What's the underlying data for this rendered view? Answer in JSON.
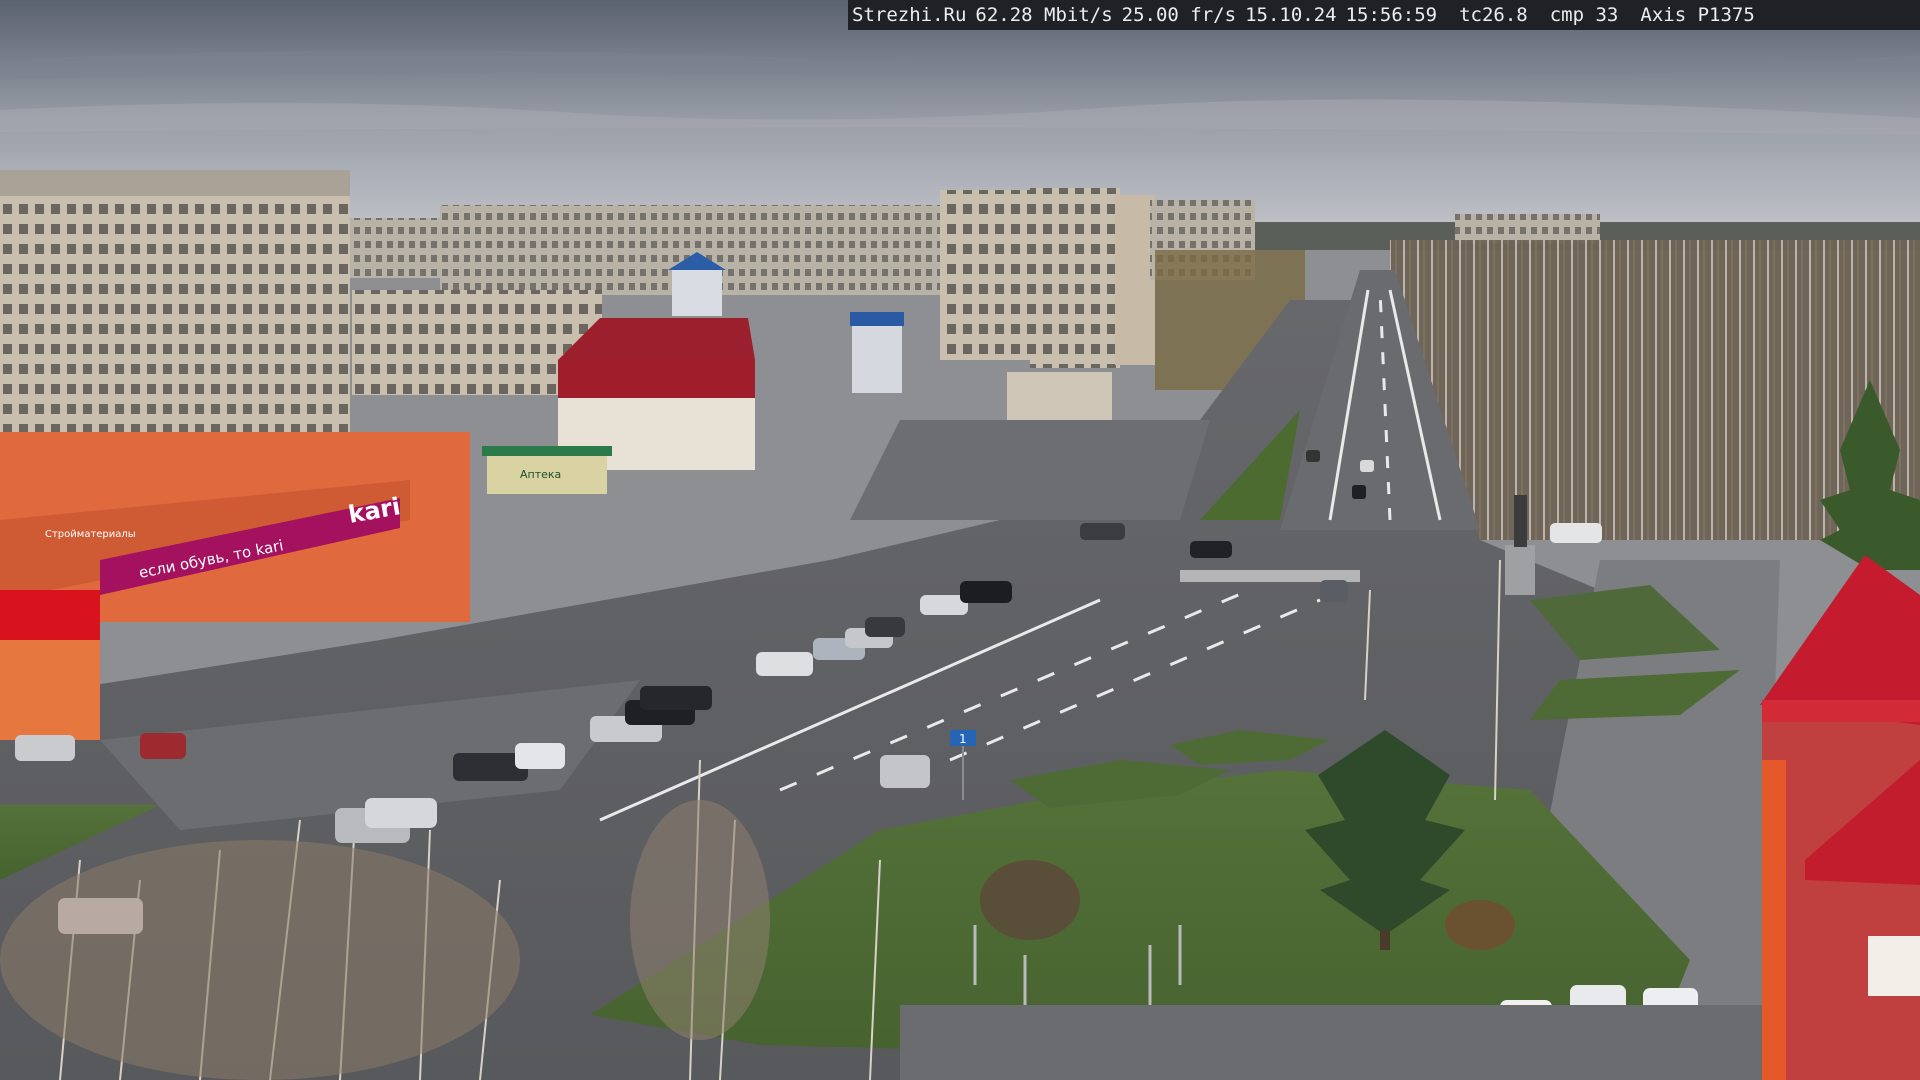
{
  "overlay": {
    "site": "Strezhi.Ru",
    "bandwidth": "62.28 Mbit/s",
    "framerate": "25.00 fr/s",
    "date": "15.10.24",
    "time": "15:56:59",
    "tc": "tc26.8",
    "cmp": "cmp 33",
    "camera": "Axis P1375"
  },
  "signs": {
    "store_logo": "kari",
    "store_slogan": "если обувь, то kari",
    "store_side_label": "Стройматериалы",
    "pharmacy_label": "Аптека",
    "street_sign": "1"
  },
  "colors": {
    "sky_top": "#5d6470",
    "sky_horizon": "#b9bcc2",
    "asphalt": "#5f6063",
    "grass": "#4d6a33",
    "brick_facade": "#e26a3e",
    "kari_magenta": "#a3115f",
    "red_roof": "#a01d2b"
  }
}
